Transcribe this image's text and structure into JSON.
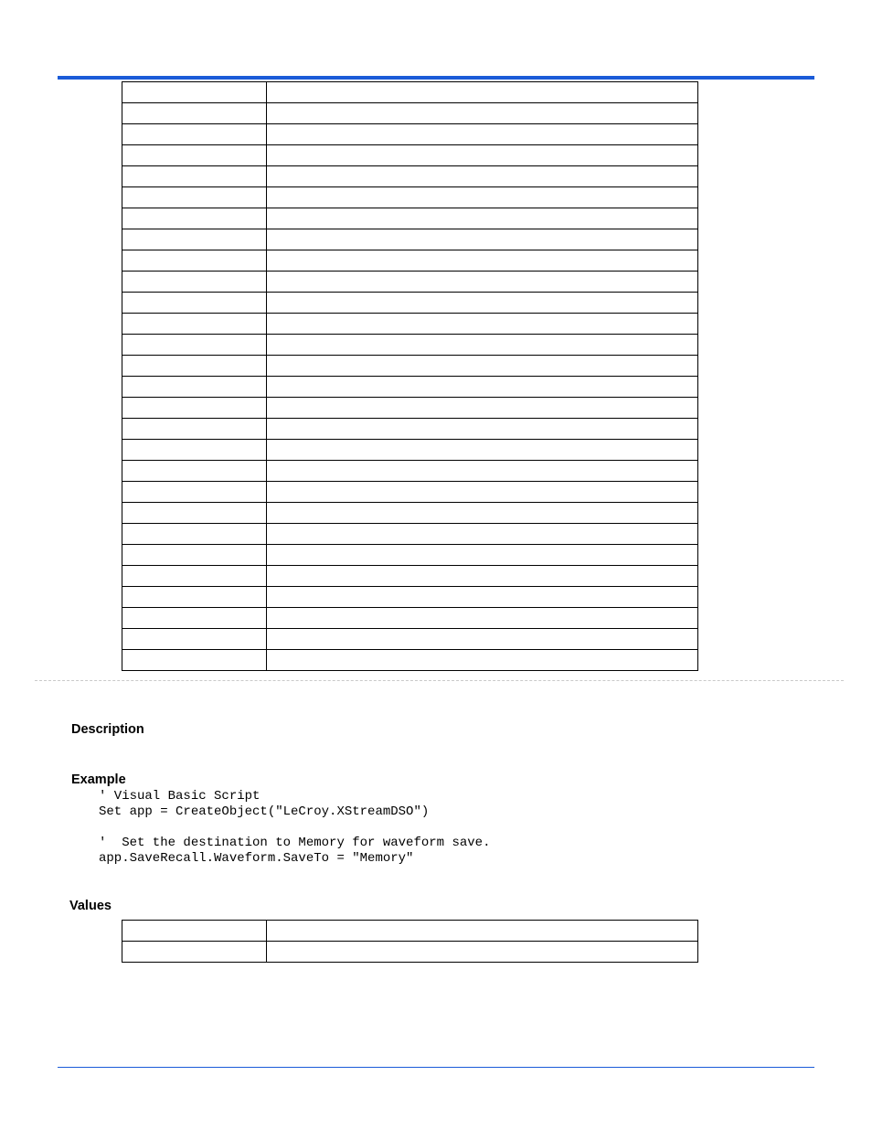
{
  "headings": {
    "description": "Description",
    "example": "Example",
    "values": "Values"
  },
  "code": "' Visual Basic Script\nSet app = CreateObject(\"LeCroy.XStreamDSO\")\n\n'  Set the destination to Memory for waveform save.\napp.SaveRecall.Waveform.SaveTo = \"Memory\"",
  "table1_rows": [
    [
      "",
      ""
    ],
    [
      "",
      ""
    ],
    [
      "",
      ""
    ],
    [
      "",
      ""
    ],
    [
      "",
      ""
    ],
    [
      "",
      ""
    ],
    [
      "",
      ""
    ],
    [
      "",
      ""
    ],
    [
      "",
      ""
    ],
    [
      "",
      ""
    ],
    [
      "",
      ""
    ],
    [
      "",
      ""
    ],
    [
      "",
      ""
    ],
    [
      "",
      ""
    ],
    [
      "",
      ""
    ],
    [
      "",
      ""
    ],
    [
      "",
      ""
    ],
    [
      "",
      ""
    ],
    [
      "",
      ""
    ],
    [
      "",
      ""
    ],
    [
      "",
      ""
    ],
    [
      "",
      ""
    ],
    [
      "",
      ""
    ],
    [
      "",
      ""
    ],
    [
      "",
      ""
    ],
    [
      "",
      ""
    ],
    [
      "",
      ""
    ],
    [
      "",
      ""
    ]
  ],
  "table2_rows": [
    [
      "",
      ""
    ],
    [
      "",
      ""
    ]
  ]
}
